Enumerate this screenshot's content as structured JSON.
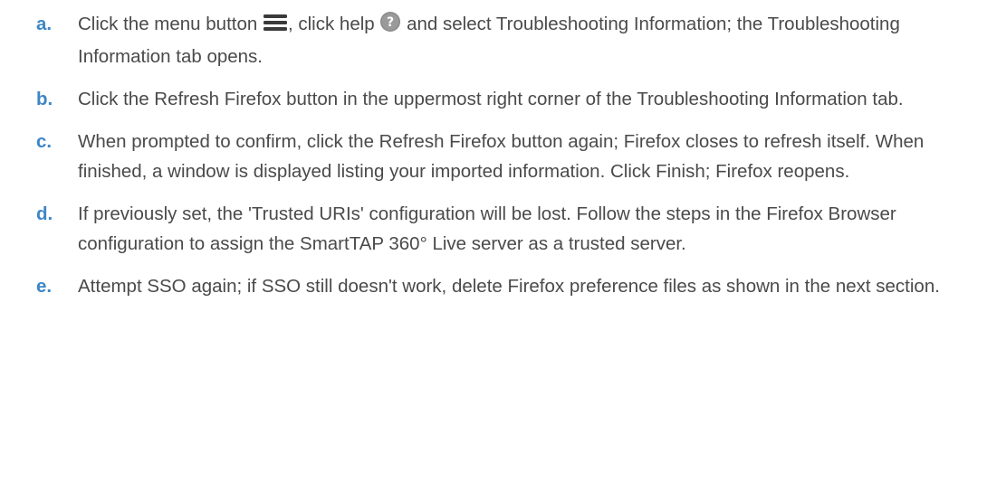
{
  "steps": [
    {
      "letter": "a.",
      "part1": "Click the menu button",
      "menu_icon": "hamburger-menu-icon",
      "part2": ", click help",
      "help_icon": "help-question-icon",
      "part3": "and select Troubleshooting Information; the Troubleshooting Information tab opens."
    },
    {
      "letter": "b.",
      "text": "Click the Refresh Firefox button in the uppermost right corner of the Troubleshooting Information tab."
    },
    {
      "letter": "c.",
      "text": "When prompted to confirm, click the Refresh Firefox button again; Firefox closes to refresh itself. When finished, a window is displayed listing your imported information. Click Finish; Firefox reopens."
    },
    {
      "letter": "d.",
      "text": "If previously set, the 'Trusted URIs' configuration will be lost. Follow the steps in the Firefox Browser configuration to assign the SmartTAP 360° Live server as a trusted server."
    },
    {
      "letter": "e.",
      "text": "Attempt SSO again; if SSO still doesn't work, delete Firefox preference files as shown in the next section."
    }
  ],
  "colors": {
    "step_letter": "#3d86c6",
    "body_text": "#4a4a4a",
    "menu_icon": "#3a3a3a",
    "help_icon": "#8a8a8a"
  }
}
